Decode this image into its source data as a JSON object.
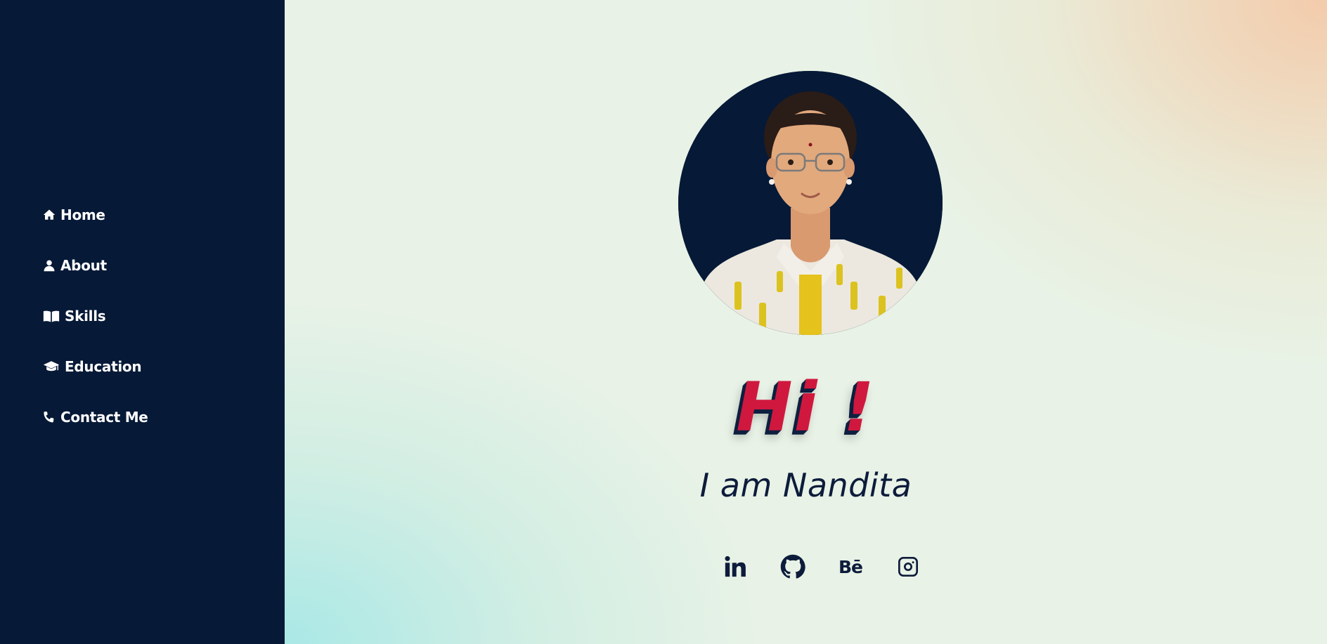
{
  "sidebar": {
    "background": "#061937",
    "items": [
      {
        "label": "Home",
        "icon": "home-icon"
      },
      {
        "label": "About",
        "icon": "user-icon"
      },
      {
        "label": "Skills",
        "icon": "book-icon"
      },
      {
        "label": "Education",
        "icon": "graduation-cap-icon"
      },
      {
        "label": "Contact Me",
        "icon": "phone-icon"
      }
    ]
  },
  "hero": {
    "greeting": "Hi !",
    "subtitle": "I am Nandita",
    "greeting_color": "#d0183e",
    "text_color": "#0d1c3b"
  },
  "socials": [
    {
      "name": "linkedin-icon"
    },
    {
      "name": "github-icon"
    },
    {
      "name": "behance-icon",
      "label": "Bē"
    },
    {
      "name": "instagram-icon"
    }
  ]
}
